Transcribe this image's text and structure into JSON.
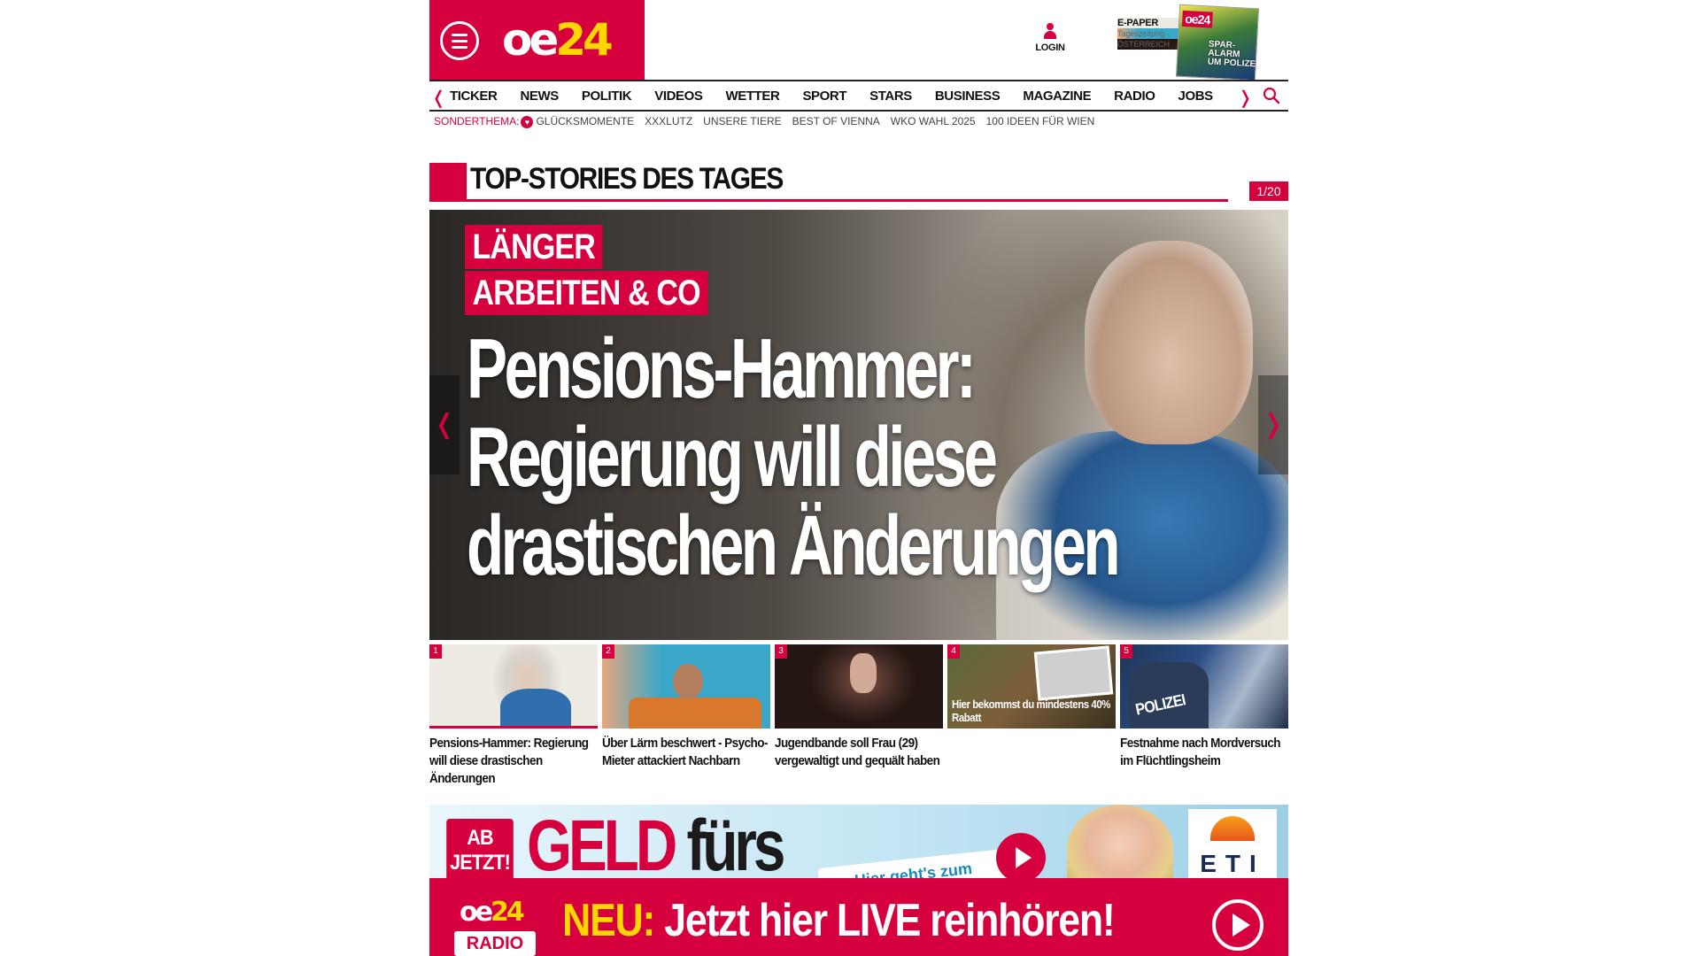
{
  "header": {
    "logo_oe": "oe",
    "logo_24": "24",
    "login_label": "LOGIN",
    "epaper": {
      "title": "E-PAPER",
      "line2": "Tageszeitung",
      "line3": "ÖSTERREICH",
      "cover_logo": "oe24",
      "cover_headline": "SPAR-\nALARM\nUM POLIZEI"
    }
  },
  "nav": {
    "items": [
      "TICKER",
      "NEWS",
      "POLITIK",
      "VIDEOS",
      "WETTER",
      "SPORT",
      "STARS",
      "BUSINESS",
      "MAGAZINE",
      "RADIO",
      "JOBS"
    ]
  },
  "subnav": {
    "label": "SONDERTHEMA:",
    "items": [
      "GLÜCKSMOMENTE",
      "XXXLUTZ",
      "UNSERE TIERE",
      "BEST OF VIENNA",
      "WKO WAHL 2025",
      "100 IDEEN FÜR WIEN"
    ]
  },
  "section": {
    "title": "TOP-STORIES DES TAGES",
    "counter": "1/20"
  },
  "hero": {
    "kicker": [
      "LÄNGER",
      "ARBEITEN & CO"
    ],
    "headline": [
      "Pensions-Hammer:",
      "Regierung will diese",
      "drastischen Änderungen"
    ]
  },
  "thumbs": [
    {
      "num": "1",
      "caption": "Pensions-Hammer: Regierung will diese drastischen Änderungen"
    },
    {
      "num": "2",
      "caption": "Über Lärm beschwert - Psycho-Mieter attackiert Nachbarn"
    },
    {
      "num": "3",
      "caption": "Jugendbande soll Frau (29) vergewaltigt und gequält haben"
    },
    {
      "num": "4",
      "caption": "",
      "overlay": "Hier bekommst du mindestens 40% Rabatt"
    },
    {
      "num": "5",
      "caption": "Festnahme nach Mordversuch im Flüchtlingsheim",
      "overlay": "POLIZEI"
    }
  ],
  "ad": {
    "badge": "AB JETZT!",
    "word1": "GELD",
    "word2": "fürs",
    "cta": "Hier geht's zum",
    "brand": "ETI"
  },
  "radio": {
    "logo_oe": "oe",
    "logo_24": "24",
    "logo_radio": "RADIO",
    "neu": "NEU:",
    "text": " Jetzt hier LIVE reinhören!"
  },
  "colors": {
    "brand_red": "#d6003e",
    "accent_yellow": "#ffd600"
  }
}
